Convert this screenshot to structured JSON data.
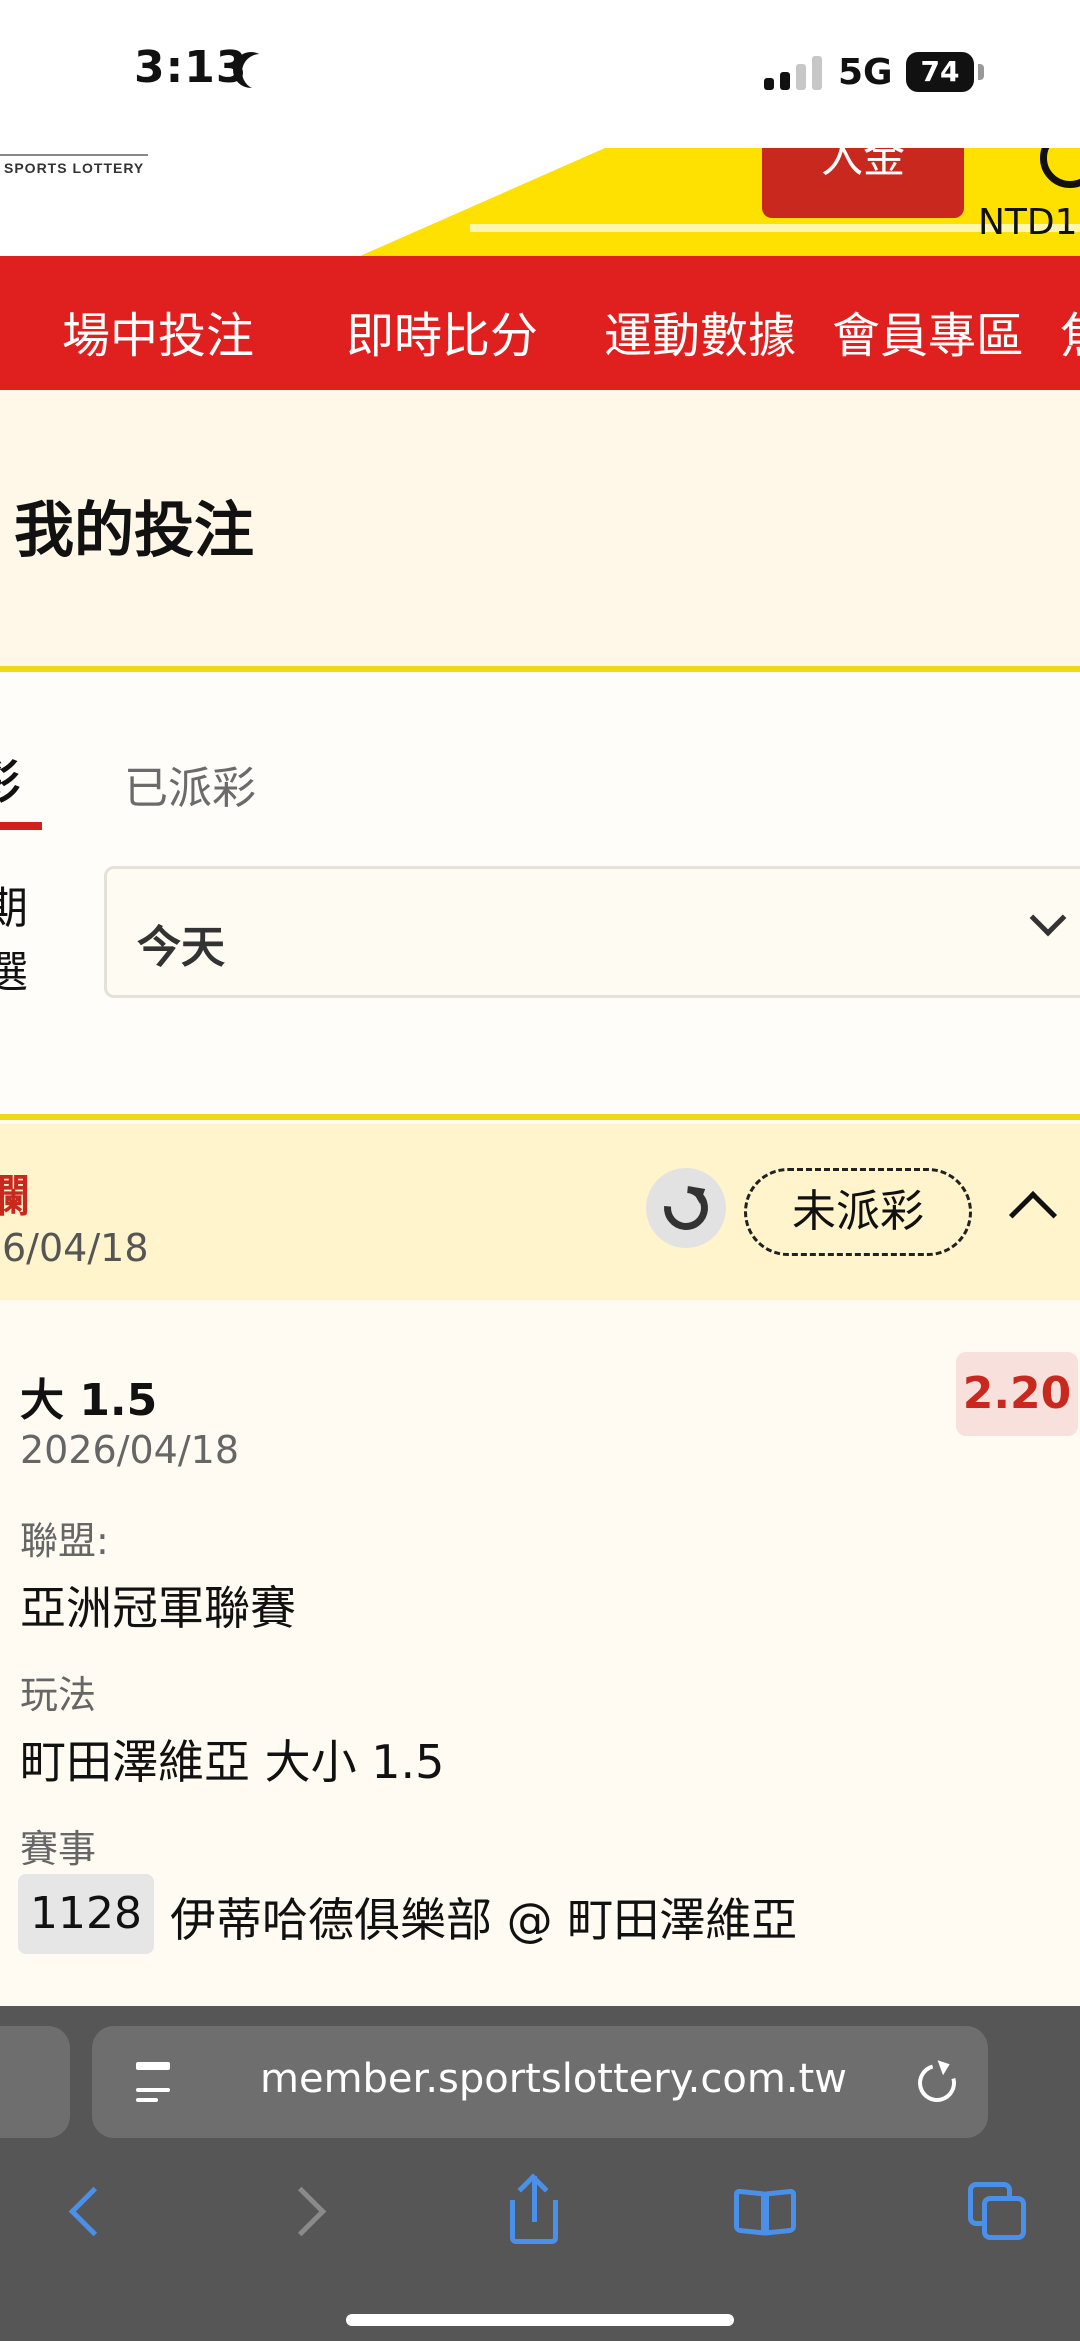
{
  "status_bar": {
    "time": "3:13",
    "network": "5G",
    "battery": "74",
    "icons": [
      "moon-icon",
      "signal-icon",
      "battery-icon"
    ]
  },
  "header": {
    "logo_text": "SPORTS LOTTERY",
    "deposit_label": "入金",
    "balance_label": "NTD1",
    "colors": {
      "brand_red": "#e0201f",
      "brand_yellow": "#ffe100"
    }
  },
  "nav": {
    "items": [
      {
        "label": "場中投注"
      },
      {
        "label": "即時比分"
      },
      {
        "label": "運動數據"
      },
      {
        "label": "會員專區"
      },
      {
        "label": "焦"
      }
    ]
  },
  "page": {
    "title": "我的投注"
  },
  "tabs": [
    {
      "label": "彩",
      "active": true
    },
    {
      "label": "已派彩",
      "active": false
    }
  ],
  "filter": {
    "label_line1": "期",
    "label_line2": "選",
    "selected": "今天"
  },
  "bet": {
    "header_label": "欄",
    "header_date": "6/04/18",
    "status": "未派彩",
    "selection": "大 1.5",
    "odds": "2.20",
    "date": "2026/04/18",
    "league_label": "聯盟:",
    "league": "亞洲冠軍聯賽",
    "market_label": "玩法",
    "market": "町田澤維亞 大小 1.5",
    "event_label": "賽事",
    "event_no": "1128",
    "event": "伊蒂哈德俱樂部 @ 町田澤維亞"
  },
  "browser": {
    "url": "member.sportslottery.com.tw",
    "icons": [
      "back-icon",
      "forward-icon",
      "share-icon",
      "bookmarks-icon",
      "tabs-icon",
      "reload-icon",
      "page-menu-icon"
    ]
  }
}
